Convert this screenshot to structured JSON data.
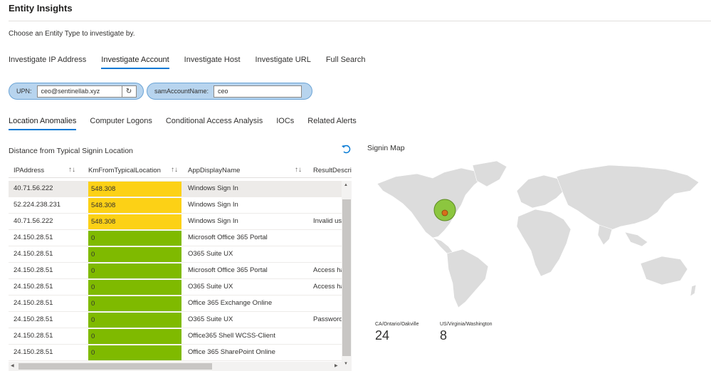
{
  "header": {
    "title": "Entity Insights"
  },
  "instruction": "Choose an Entity Type to investigate by.",
  "entity_tabs": [
    {
      "label": "Investigate IP Address",
      "active": false
    },
    {
      "label": "Investigate Account",
      "active": true
    },
    {
      "label": "Investigate Host",
      "active": false
    },
    {
      "label": "Investigate URL",
      "active": false
    },
    {
      "label": "Full Search",
      "active": false
    }
  ],
  "params": {
    "upn": {
      "label": "UPN:",
      "value": "ceo@sentinellab.xyz"
    },
    "sam": {
      "label": "samAccountName:",
      "value": "ceo"
    }
  },
  "sub_tabs": [
    {
      "label": "Location Anomalies",
      "active": true
    },
    {
      "label": "Computer Logons",
      "active": false
    },
    {
      "label": "Conditional Access Analysis",
      "active": false
    },
    {
      "label": "IOCs",
      "active": false
    },
    {
      "label": "Related Alerts",
      "active": false
    }
  ],
  "table": {
    "title": "Distance from Typical Signin Location",
    "columns": [
      "IPAddress",
      "KmFromTypicalLocation",
      "AppDisplayName",
      "ResultDescri"
    ],
    "rows": [
      {
        "ip": "40.71.56.222",
        "km": "548.308",
        "app": "Windows Sign In",
        "result": ""
      },
      {
        "ip": "52.224.238.231",
        "km": "548.308",
        "app": "Windows Sign In",
        "result": ""
      },
      {
        "ip": "40.71.56.222",
        "km": "548.308",
        "app": "Windows Sign In",
        "result": "Invalid us"
      },
      {
        "ip": "24.150.28.51",
        "km": "0",
        "app": "Microsoft Office 365 Portal",
        "result": ""
      },
      {
        "ip": "24.150.28.51",
        "km": "0",
        "app": "O365 Suite UX",
        "result": ""
      },
      {
        "ip": "24.150.28.51",
        "km": "0",
        "app": "Microsoft Office 365 Portal",
        "result": "Access ha"
      },
      {
        "ip": "24.150.28.51",
        "km": "0",
        "app": "O365 Suite UX",
        "result": "Access ha"
      },
      {
        "ip": "24.150.28.51",
        "km": "0",
        "app": "Office 365 Exchange Online",
        "result": ""
      },
      {
        "ip": "24.150.28.51",
        "km": "0",
        "app": "O365 Suite UX",
        "result": "Password"
      },
      {
        "ip": "24.150.28.51",
        "km": "0",
        "app": "Office365 Shell WCSS-Client",
        "result": ""
      },
      {
        "ip": "24.150.28.51",
        "km": "0",
        "app": "Office 365 SharePoint Online",
        "result": ""
      }
    ],
    "selected_row": 0
  },
  "map": {
    "title": "Signin Map",
    "stats": [
      {
        "label": "CA/Ontario/Oakville",
        "value": "24"
      },
      {
        "label": "US/Virginia/Washington",
        "value": "8"
      }
    ]
  },
  "colors": {
    "accent": "#0078d4",
    "heat_high": "#fcd116",
    "heat_low": "#7fba00",
    "param_bg": "#b7d4ee",
    "land": "#dcdcdc",
    "bubble_large": "#8cc63f",
    "bubble_small": "#d86f1a"
  },
  "icons": {
    "refresh": "refresh-icon",
    "undo": "undo-icon",
    "sort": "sort-icon"
  }
}
